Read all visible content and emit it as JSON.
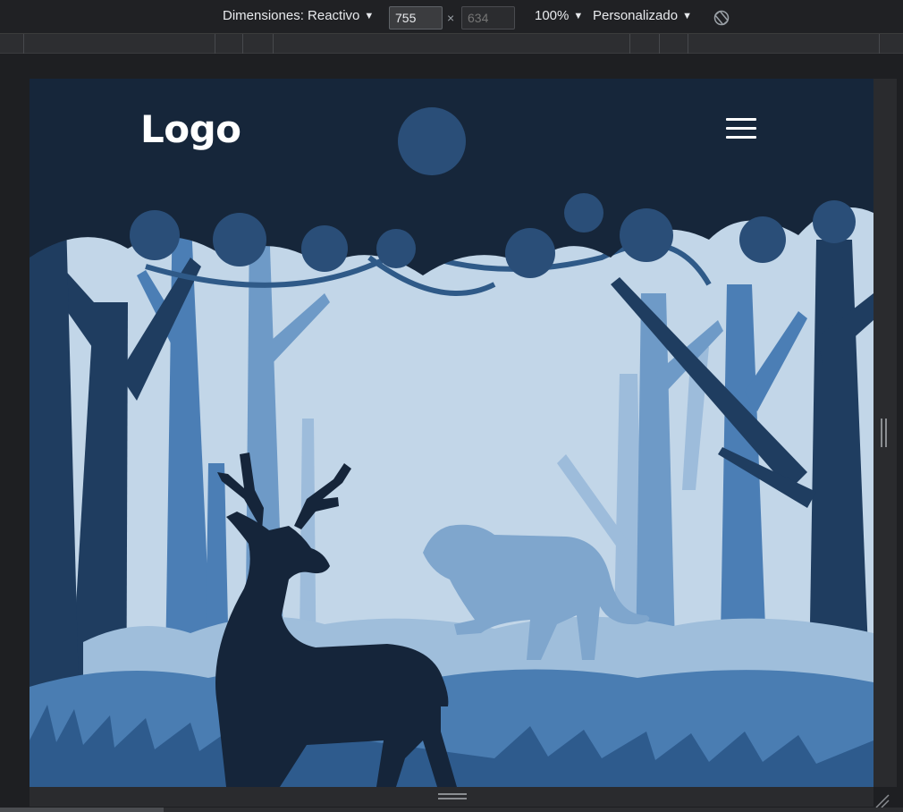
{
  "toolbar": {
    "dimensions_label": "Dimensiones: Reactivo",
    "width_value": "755",
    "height_placeholder": "634",
    "times_symbol": "×",
    "zoom_label": "100%",
    "throttle_label": "Personalizado",
    "caret": "▼",
    "rotate_icon": "rotate-icon"
  },
  "site": {
    "logo_text": "Logo",
    "menu_icon": "hamburger-menu-icon"
  },
  "colors": {
    "sky": "#c2d6e8",
    "canopy_dark": "#16263a",
    "tree_dark": "#1e3a5c",
    "tree_mid": "#3d6ea3",
    "tree_light": "#7fa8cf",
    "deer": "#15253a",
    "tiger": "#7fa6cd",
    "grass_front": "#2e5b8d"
  }
}
